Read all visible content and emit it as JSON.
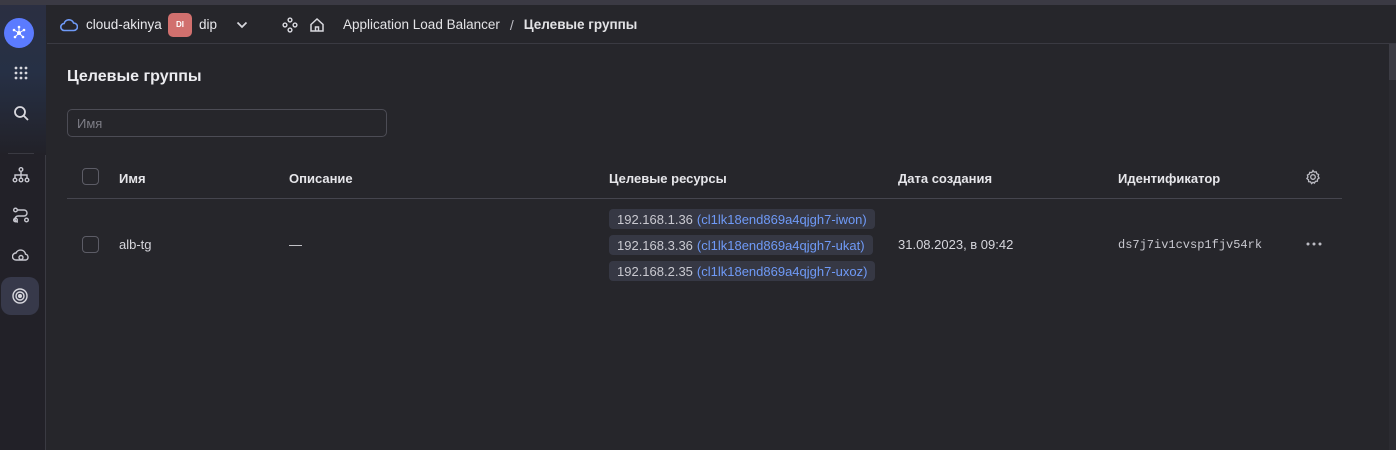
{
  "header": {
    "cloud_name": "cloud-akinya",
    "folder_badge": "DI",
    "folder_name": "dip",
    "breadcrumb_service": "Application Load Balancer",
    "breadcrumb_separator": "/",
    "breadcrumb_current": "Целевые группы"
  },
  "page": {
    "title": "Целевые группы",
    "filter_placeholder": "Имя"
  },
  "table": {
    "columns": [
      "Имя",
      "Описание",
      "Целевые ресурсы",
      "Дата создания",
      "Идентификатор"
    ],
    "rows": [
      {
        "name": "alb-tg",
        "description": "—",
        "resources": [
          {
            "ip": "192.168.1.36",
            "instance": "(cl1lk18end869a4qjgh7-iwon)"
          },
          {
            "ip": "192.168.3.36",
            "instance": "(cl1lk18end869a4qjgh7-ukat)"
          },
          {
            "ip": "192.168.2.35",
            "instance": "(cl1lk18end869a4qjgh7-uxoz)"
          }
        ],
        "created": "31.08.2023, в 09:42",
        "id": "ds7j7iv1cvsp1fjv54rk"
      }
    ]
  },
  "icons": {
    "rail": [
      "services-logo-icon",
      "all-services-grid-icon",
      "search-icon",
      "target-groups-tree-icon",
      "routers-icon",
      "backend-groups-icon",
      "load-balancer-target-icon"
    ],
    "header": [
      "cloud-icon",
      "chevron-down-icon",
      "org-structure-icon",
      "home-icon"
    ],
    "table": [
      "settings-gear-icon",
      "more-actions-icon"
    ]
  },
  "colors": {
    "background": "#26262b",
    "accent": "#5b7bff",
    "link": "#6f9af7",
    "folder_badge": "#d1706e"
  }
}
